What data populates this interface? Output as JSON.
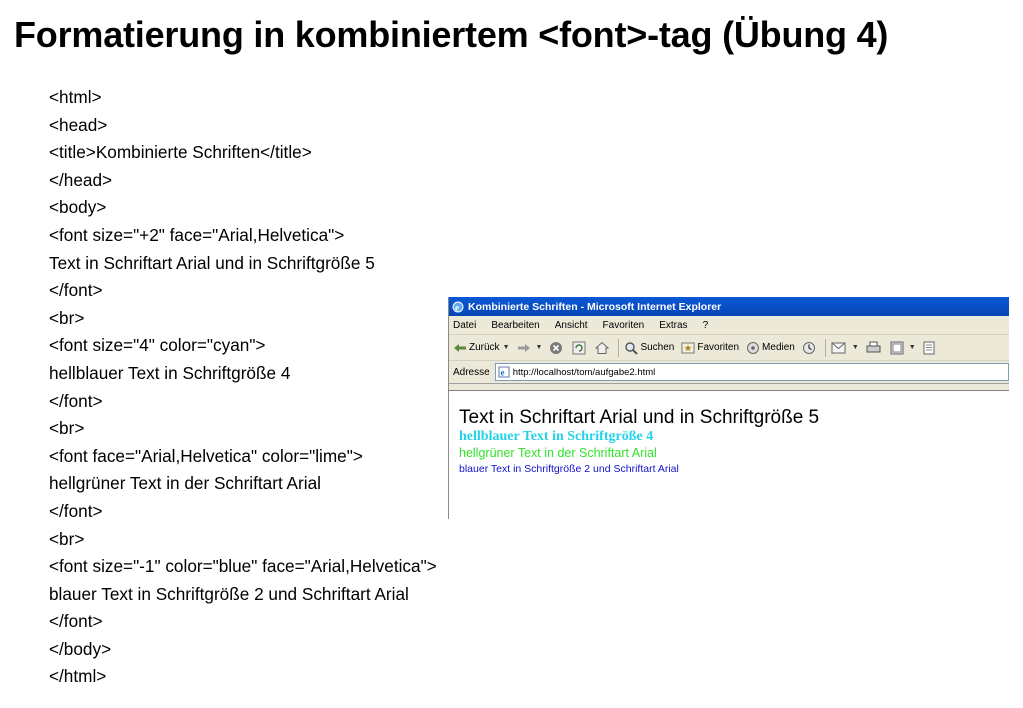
{
  "slide": {
    "title": "Formatierung in kombiniertem <font>-tag (Übung 4)",
    "code_lines": [
      "<html>",
      "<head>",
      "<title>Kombinierte Schriften</title>",
      "</head>",
      "<body>",
      "<font size=\"+2\" face=\"Arial,Helvetica\">",
      "Text in Schriftart Arial und in Schriftgröße 5",
      "</font>",
      "<br>",
      "<font size=\"4\" color=\"cyan\">",
      "hellblauer Text in Schriftgröße 4",
      "</font>",
      "<br>",
      "<font face=\"Arial,Helvetica\" color=\"lime\">",
      "hellgrüner Text in der Schriftart Arial",
      "</font>",
      "<br>",
      "<font size=\"-1\" color=\"blue\" face=\"Arial,Helvetica\">",
      "blauer Text in Schriftgröße 2 und Schriftart Arial",
      "</font>",
      "</body>",
      "</html>"
    ]
  },
  "browser": {
    "window_title": "Kombinierte Schriften - Microsoft Internet Explorer",
    "menu": [
      "Datei",
      "Bearbeiten",
      "Ansicht",
      "Favoriten",
      "Extras",
      "?"
    ],
    "toolbar": {
      "back": "Zurück",
      "search": "Suchen",
      "favorites": "Favoriten",
      "media": "Medien"
    },
    "address_label": "Adresse",
    "address_url": "http://localhost/tom/aufgabe2.html",
    "content": {
      "line1": "Text in Schriftart Arial und in Schriftgröße 5",
      "line2": "hellblauer Text in Schriftgröße 4",
      "line3": "hellgrüner Text in der Schriftart Arial",
      "line4": "blauer Text in Schriftgröße 2 und Schriftart Arial"
    },
    "icons": [
      "ie-app-icon",
      "back-arrow-icon",
      "forward-arrow-icon",
      "stop-icon",
      "refresh-icon",
      "home-icon",
      "search-icon",
      "favorites-icon",
      "media-icon",
      "history-icon",
      "mail-icon",
      "print-icon",
      "edit-icon",
      "discuss-icon",
      "page-icon"
    ],
    "colors": {
      "titlebar": "#0a58d6",
      "cyan": "#22d2e6",
      "lime": "#33e22c",
      "blue": "#1212c8"
    }
  }
}
